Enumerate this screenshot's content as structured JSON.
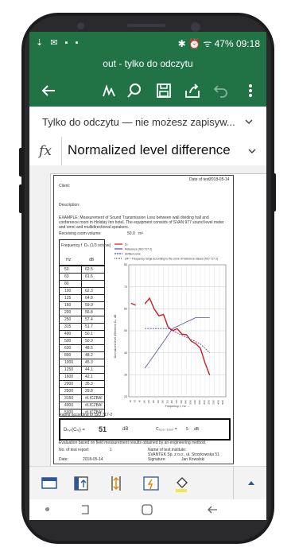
{
  "status": {
    "left_icons": "⇣ ✉ ▪ ▪",
    "right": "✱ ⏰ ᯤ 47% 09:18"
  },
  "title": "out - tylko do odczytu",
  "notice": "Tylko do odczytu — nie możesz zapisyw...",
  "formula": {
    "fx": "fx",
    "value": "Normalized level difference"
  },
  "sheet": {
    "date_label": "Date of test:",
    "date": "2018-05-14",
    "client": "Client:",
    "description": "Description:",
    "example": "EXAMPLE: Measurement of Sound Transmission Loss between wall dividing hall and conference room in Holiday Inn hotel. The equipment consists of SVAN 977 sound level meter and omni and multidirectional speakers.",
    "room_volume": "Receiving room volume:",
    "room_volume_value": "50.0",
    "room_volume_unit": "m³",
    "table_head": {
      "freq": "Frequency f",
      "freq_unit": "Hz",
      "dn": "Dₙ (1/3 octave)",
      "dn_unit": "dB"
    },
    "rows": [
      {
        "f": "50",
        "v": "62.5"
      },
      {
        "f": "63",
        "v": "61.6"
      },
      {
        "f": "80",
        "v": ""
      },
      {
        "f": "100",
        "v": "62.3"
      },
      {
        "f": "125",
        "v": "64.8"
      },
      {
        "f": "160",
        "v": "59.9"
      },
      {
        "f": "200",
        "v": "56.8"
      },
      {
        "f": "250",
        "v": "57.4"
      },
      {
        "f": "315",
        "v": "51.7"
      },
      {
        "f": "400",
        "v": "50.1"
      },
      {
        "f": "500",
        "v": "50.9"
      },
      {
        "f": "630",
        "v": "48.5"
      },
      {
        "f": "800",
        "v": "48.2"
      },
      {
        "f": "1000",
        "v": "45.3"
      },
      {
        "f": "1250",
        "v": "44.1"
      },
      {
        "f": "1600",
        "v": "42.1"
      },
      {
        "f": "2000",
        "v": "35.3"
      },
      {
        "f": "2500",
        "v": "29.8"
      },
      {
        "f": "3150",
        "v": "#LICZBA!"
      },
      {
        "f": "4000",
        "v": "#LICZBA!"
      },
      {
        "f": "5000",
        "v": "#LICZBA!"
      }
    ],
    "legend": [
      "Dₙ",
      "Reference (ISO 717-2)",
      "Shifted curve",
      "ΔΦ = Frequency range according to the curve of reference values (ISO 717-2)"
    ],
    "y_label": "Normalized level difference Dₙ, dB",
    "x_label": "Frequency, f, Hz →",
    "rating_label": "Rating according to ISO 717-2",
    "rating_value": "51",
    "rating_unit": "dB",
    "c_label": "C₍₁₀₀₋₃₁₅₀₎ =",
    "c_value": "5",
    "c_unit": "dB",
    "eval_note": "Evaluation based on field measurement results obtained by an engineering method.",
    "test_report_label": "No. of test report:",
    "test_report_value": "1",
    "institute_label": "Name of test institute:",
    "institute_value": "SVANTEK Sp. z o.o., ul. Strzykowska 51",
    "date_bottom_label": "Date:",
    "date_bottom_value": "2018-05-14",
    "signature_label": "Signature:",
    "signature_value": "Jan Kowalski"
  },
  "chart_data": {
    "type": "line",
    "x": [
      50,
      63,
      80,
      100,
      125,
      160,
      200,
      250,
      315,
      400,
      500,
      630,
      800,
      1000,
      1250,
      1600,
      2000,
      2500,
      3150,
      4000,
      5000
    ],
    "y_ticks": [
      20,
      30,
      40,
      50,
      60,
      70,
      80
    ],
    "ylim": [
      20,
      80
    ],
    "series": [
      {
        "name": "Dₙ",
        "color": "#d11b1b",
        "values": [
          62.5,
          61.6,
          null,
          62.3,
          64.8,
          59.9,
          56.8,
          57.4,
          51.7,
          50.1,
          50.9,
          48.5,
          48.2,
          45.3,
          44.1,
          42.1,
          35.3,
          29.8,
          null,
          null,
          null
        ]
      },
      {
        "name": "Reference (ISO 717-2)",
        "color": "#4a4ab0",
        "values": [
          null,
          null,
          null,
          33,
          36,
          39,
          42,
          45,
          48,
          51,
          52,
          53,
          54,
          55,
          56,
          56,
          56,
          56,
          null,
          null,
          null
        ]
      },
      {
        "name": "Shifted curve",
        "color": "#4a4ab0",
        "values": [
          null,
          null,
          null,
          51,
          51,
          51,
          51,
          51,
          51,
          50,
          49,
          48,
          47,
          46,
          45,
          44,
          42,
          40,
          null,
          null,
          null
        ]
      }
    ]
  },
  "bottom_toolbar": [
    "sheet-icon",
    "freeze-column-icon",
    "autofit-column-icon",
    "autofit-row-icon",
    "fill-color-icon"
  ],
  "colors": {
    "accent": "#217346",
    "series_red": "#d11b1b",
    "series_blue": "#4a4ab0"
  }
}
